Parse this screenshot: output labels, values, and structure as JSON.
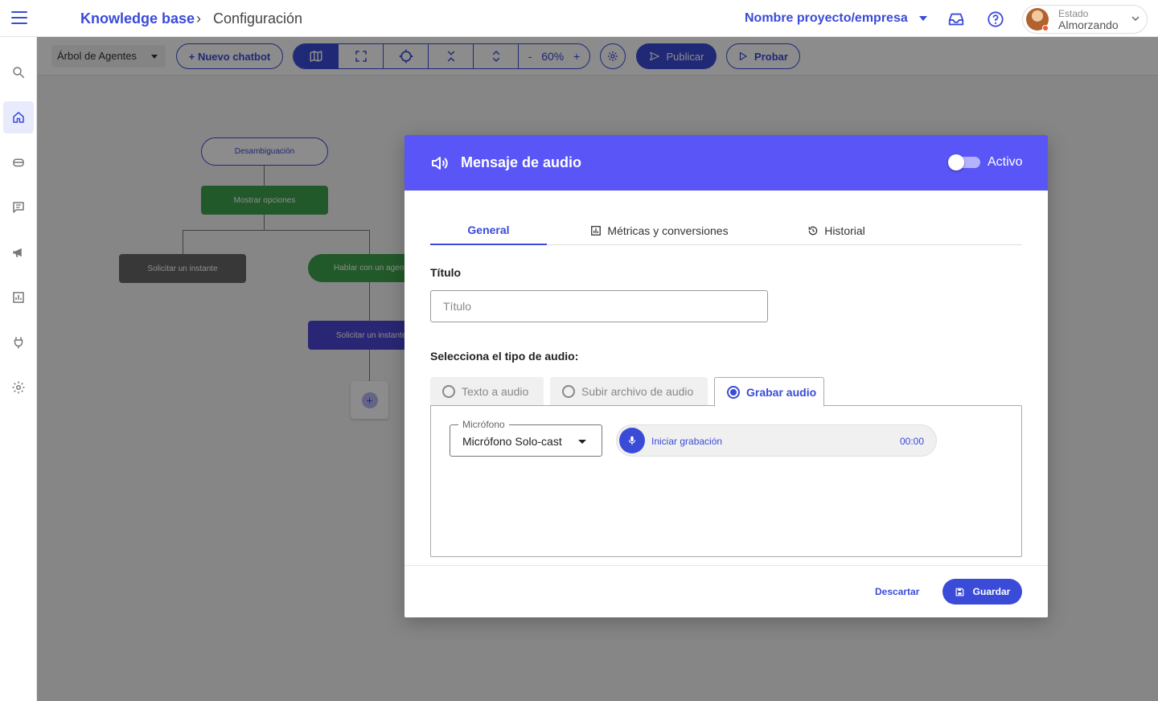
{
  "header": {
    "breadcrumb": [
      "Knowledge base",
      "Configuración"
    ],
    "separator": "›",
    "project": "Nombre proyecto/empresa",
    "status_label": "Estado",
    "status_value": "Almorzando",
    "icons": [
      "menu-icon",
      "inbox-icon",
      "help-icon",
      "chevron-down-icon"
    ]
  },
  "sidebar": {
    "items": [
      "search-icon",
      "home-icon",
      "bot-icon",
      "chat-icon",
      "megaphone-icon",
      "analytics-icon",
      "plug-icon",
      "settings-icon"
    ],
    "active_index": 1
  },
  "toolbar": {
    "tree_select": "Árbol de Agentes",
    "new_chatbot": "+ Nuevo chatbot",
    "zoom": "60%",
    "zoom_minus": "-",
    "zoom_plus": "+",
    "publish": "Publicar",
    "test": "Probar"
  },
  "flow": {
    "nodes": [
      "Desambiguación",
      "Mostrar opciones",
      "Solicitar un instante",
      "Hablar con un agente",
      "Solicitar un instante",
      "+"
    ]
  },
  "modal": {
    "title": "Mensaje de audio",
    "active_label": "Activo",
    "active": false,
    "tabs": [
      "General",
      "Métricas y conversiones",
      "Historial"
    ],
    "active_tab": 0,
    "title_label": "Título",
    "title_placeholder": "Título",
    "title_value": "",
    "audio_type_label": "Selecciona el tipo de audio:",
    "audio_types": [
      "Texto a audio",
      "Subir archivo de audio",
      "Grabar audio"
    ],
    "selected_audio_type": 2,
    "mic_label": "Micrófono",
    "mic_value": "Micrófono Solo-cast",
    "record_label": "Iniciar grabación",
    "record_time": "00:00",
    "discard": "Descartar",
    "save": "Guardar"
  },
  "colors": {
    "accent": "#3a4bd8",
    "modal_header": "#5a55f7",
    "node_green": "#3fa34d",
    "node_gray": "#666666",
    "node_purple": "#4b47d6"
  }
}
